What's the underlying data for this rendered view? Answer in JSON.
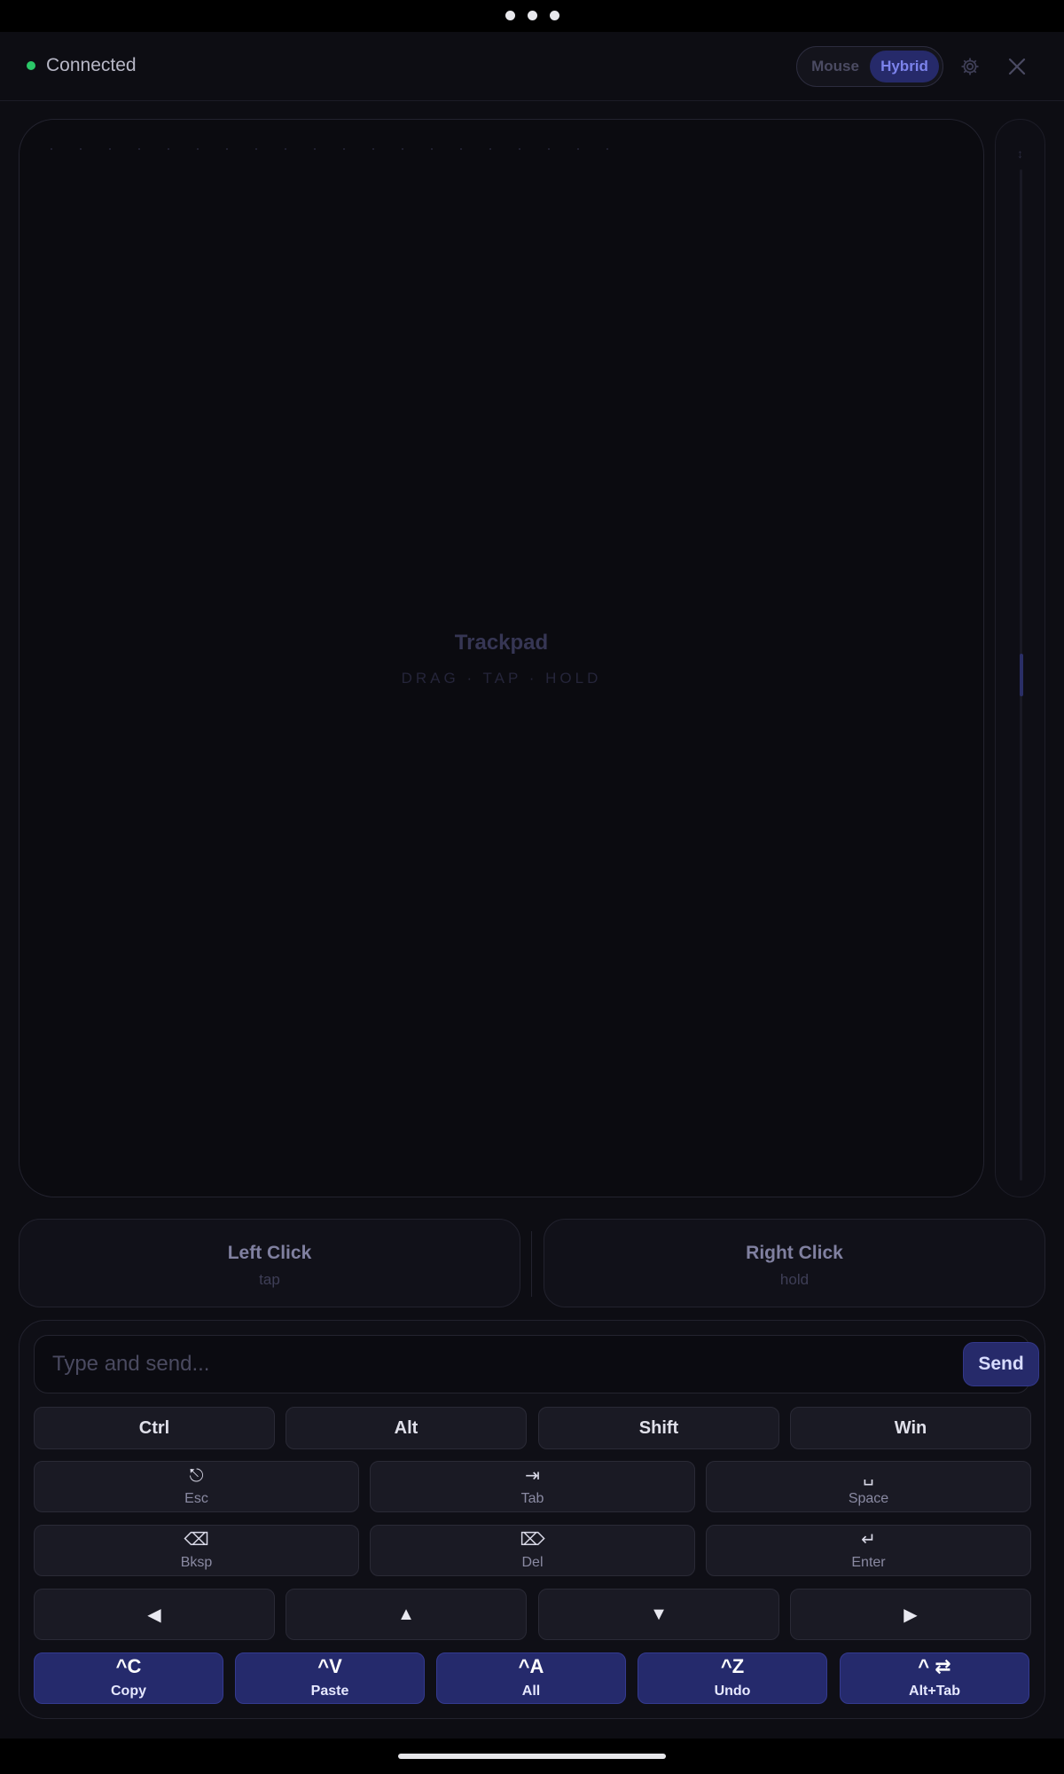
{
  "header": {
    "status_text": "Connected",
    "status_color": "#2bc768",
    "mode_options": [
      "Mouse",
      "Hybrid"
    ],
    "selected_mode": "Hybrid",
    "settings_icon": "gear-icon",
    "close_icon": "close-icon"
  },
  "trackpad": {
    "label": "Trackpad",
    "hint": "DRAG · TAP · HOLD"
  },
  "scroll": {
    "arrow": "↕"
  },
  "clicks": {
    "left": {
      "label": "Left Click",
      "sub": "tap"
    },
    "right": {
      "label": "Right Click",
      "sub": "hold"
    }
  },
  "keyboard": {
    "input_placeholder": "Type and send...",
    "input_value": "",
    "send_label": "Send",
    "modifiers": [
      "Ctrl",
      "Alt",
      "Shift",
      "Win"
    ],
    "special_keys": [
      {
        "glyph": "⎋",
        "label": "Esc",
        "icon": "escape-icon"
      },
      {
        "glyph": "⇥",
        "label": "Tab",
        "icon": "tab-icon"
      },
      {
        "glyph": "␣",
        "label": "Space",
        "icon": "space-icon"
      },
      {
        "glyph": "⌫",
        "label": "Bksp",
        "icon": "backspace-icon"
      },
      {
        "glyph": "⌦",
        "label": "Del",
        "icon": "delete-icon"
      },
      {
        "glyph": "↵",
        "label": "Enter",
        "icon": "enter-icon"
      }
    ],
    "arrows": [
      "◀",
      "▲",
      "▼",
      "▶"
    ],
    "shortcuts": [
      {
        "combo": "^C",
        "label": "Copy"
      },
      {
        "combo": "^V",
        "label": "Paste"
      },
      {
        "combo": "^A",
        "label": "All"
      },
      {
        "combo": "^Z",
        "label": "Undo"
      },
      {
        "combo": "^ ⇄",
        "label": "Alt+Tab"
      }
    ],
    "accent_color": "#262a6a"
  }
}
